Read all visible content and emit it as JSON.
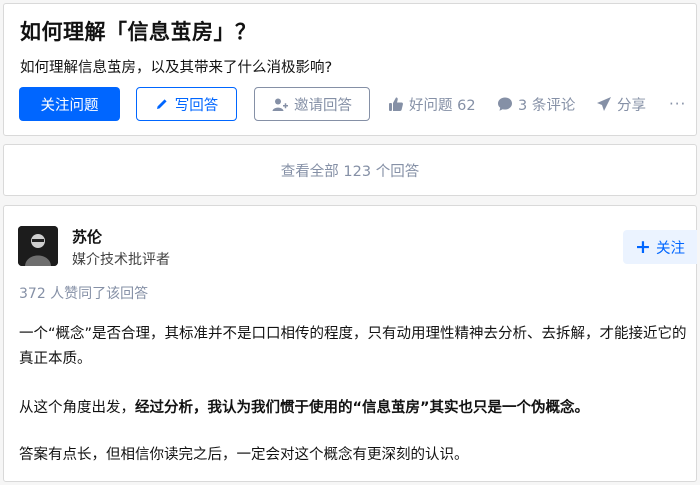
{
  "question": {
    "title": "如何理解「信息茧房」？",
    "description": "如何理解信息茧房，以及其带来了什么消极影响?",
    "actions": {
      "follow_label": "关注问题",
      "answer_label": "写回答",
      "invite_label": "邀请回答",
      "like_label": "好问题 62",
      "comment_label": "3 条评论",
      "share_label": "分享",
      "more_label": "···"
    }
  },
  "view_all_label": "查看全部 123 个回答",
  "answer": {
    "author_name": "苏伦",
    "author_bio": "媒介技术批评者",
    "follow_label": "关注",
    "votes_text": "372 人赞同了该回答",
    "paragraphs": [
      "一个“概念”是否合理，其标准并不是口口相传的程度，只有动用理性精神去分析、去拆解，才能接近它的真正本质。",
      "从这个角度出发，",
      "经过分析，我认为我们惯于使用的“信息茧房”其实也只是一个伪概念。",
      "答案有点长，但相信你读完之后，一定会对这个概念有更深刻的认识。"
    ]
  },
  "colors": {
    "brand_blue": "#0066ff",
    "muted": "#8590a6",
    "follow_bg": "#ebf3ff"
  }
}
